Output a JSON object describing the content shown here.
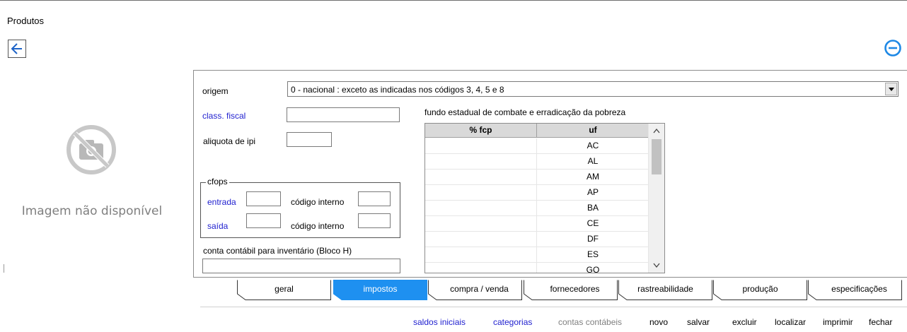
{
  "window": {
    "title": "Produtos"
  },
  "image_placeholder": {
    "text": "Imagem não disponível",
    "icon": "no-photo-icon"
  },
  "form": {
    "origem_label": "origem",
    "origem_value": "0 - nacional : exceto as indicadas nos códigos 3, 4, 5 e 8",
    "class_fiscal_label": "class. fiscal",
    "class_fiscal_value": "",
    "aliquota_ipi_label": "aliquota de ipi",
    "aliquota_ipi_value": "",
    "cfops": {
      "legend": "cfops",
      "entrada_label": "entrada",
      "saida_label": "saída",
      "codigo_interno_label": "código interno",
      "entrada_value": "",
      "entrada_codigo_value": "",
      "saida_value": "",
      "saida_codigo_value": ""
    },
    "conta_contabil_label": "conta contábil para inventário (Bloco H)",
    "conta_contabil_value": ""
  },
  "fcp": {
    "title": "fundo estadual de combate e erradicação da pobreza",
    "columns": [
      "% fcp",
      "uf"
    ],
    "rows": [
      {
        "fcp": "",
        "uf": "AC"
      },
      {
        "fcp": "",
        "uf": "AL"
      },
      {
        "fcp": "",
        "uf": "AM"
      },
      {
        "fcp": "",
        "uf": "AP"
      },
      {
        "fcp": "",
        "uf": "BA"
      },
      {
        "fcp": "",
        "uf": "CE"
      },
      {
        "fcp": "",
        "uf": "DF"
      },
      {
        "fcp": "",
        "uf": "ES"
      },
      {
        "fcp": "",
        "uf": "GO"
      }
    ]
  },
  "tabs": [
    {
      "label": "geral",
      "active": false
    },
    {
      "label": "impostos",
      "active": true
    },
    {
      "label": "compra / venda",
      "active": false
    },
    {
      "label": "fornecedores",
      "active": false
    },
    {
      "label": "rastreabilidade",
      "active": false
    },
    {
      "label": "produção",
      "active": false
    },
    {
      "label": "especificações",
      "active": false
    }
  ],
  "footer_links": [
    {
      "label": "saldos iniciais",
      "style": "blue"
    },
    {
      "label": "categorias",
      "style": "blue"
    },
    {
      "label": "contas contábeis",
      "style": "gray"
    },
    {
      "label": "novo",
      "style": "black"
    },
    {
      "label": "salvar",
      "style": "black"
    },
    {
      "label": "excluir",
      "style": "black"
    },
    {
      "label": "localizar",
      "style": "black"
    },
    {
      "label": "imprimir",
      "style": "black"
    },
    {
      "label": "fechar",
      "style": "black"
    }
  ],
  "colors": {
    "accent": "#1e88e5",
    "link_blue": "#1f1fcf",
    "tab_active": "#1e90f0"
  }
}
